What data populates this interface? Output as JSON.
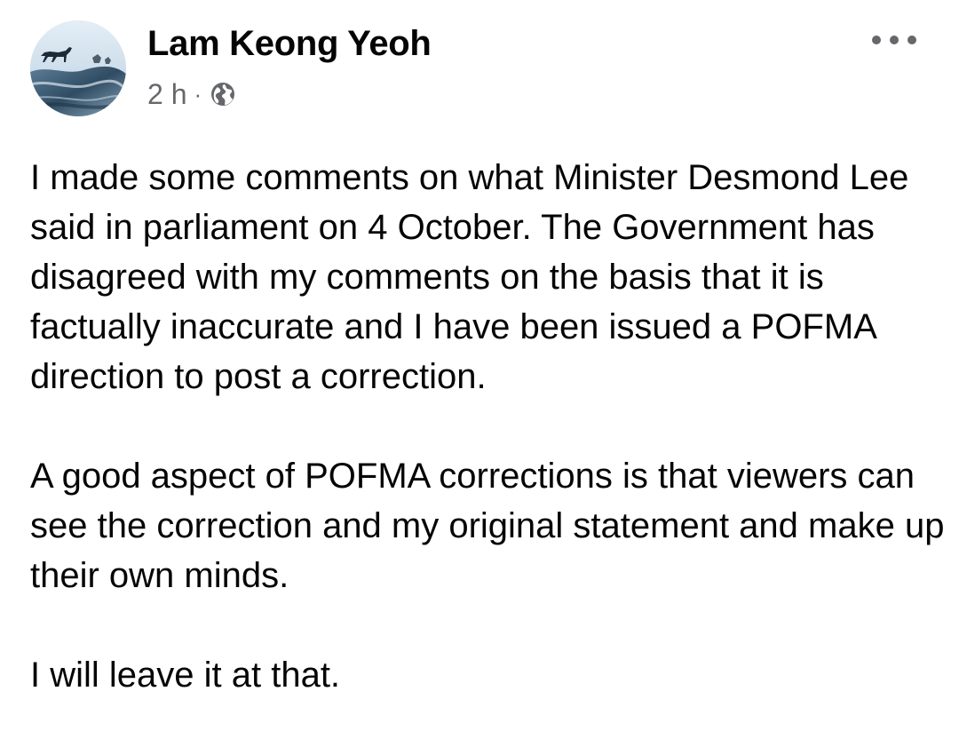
{
  "post": {
    "author": {
      "name": "Lam Keong Yeoh",
      "avatar_icon": "avatar-landscape-horse"
    },
    "meta": {
      "time": "2 h",
      "separator": "·",
      "audience_icon": "globe-icon"
    },
    "menu_icon": "more-options-icon",
    "paragraphs": [
      "I made some comments on what Minister Desmond Lee said in parliament on 4 October. The Government has disagreed with my comments on the basis that it is factually inaccurate and I have been issued a POFMA direction to post a correction.",
      "A good aspect of POFMA corrections is that viewers can see the correction and my original statement and make up their own minds.",
      "I will leave it at that."
    ]
  },
  "colors": {
    "text_primary": "#050505",
    "text_secondary": "#65676b",
    "background": "#ffffff"
  }
}
